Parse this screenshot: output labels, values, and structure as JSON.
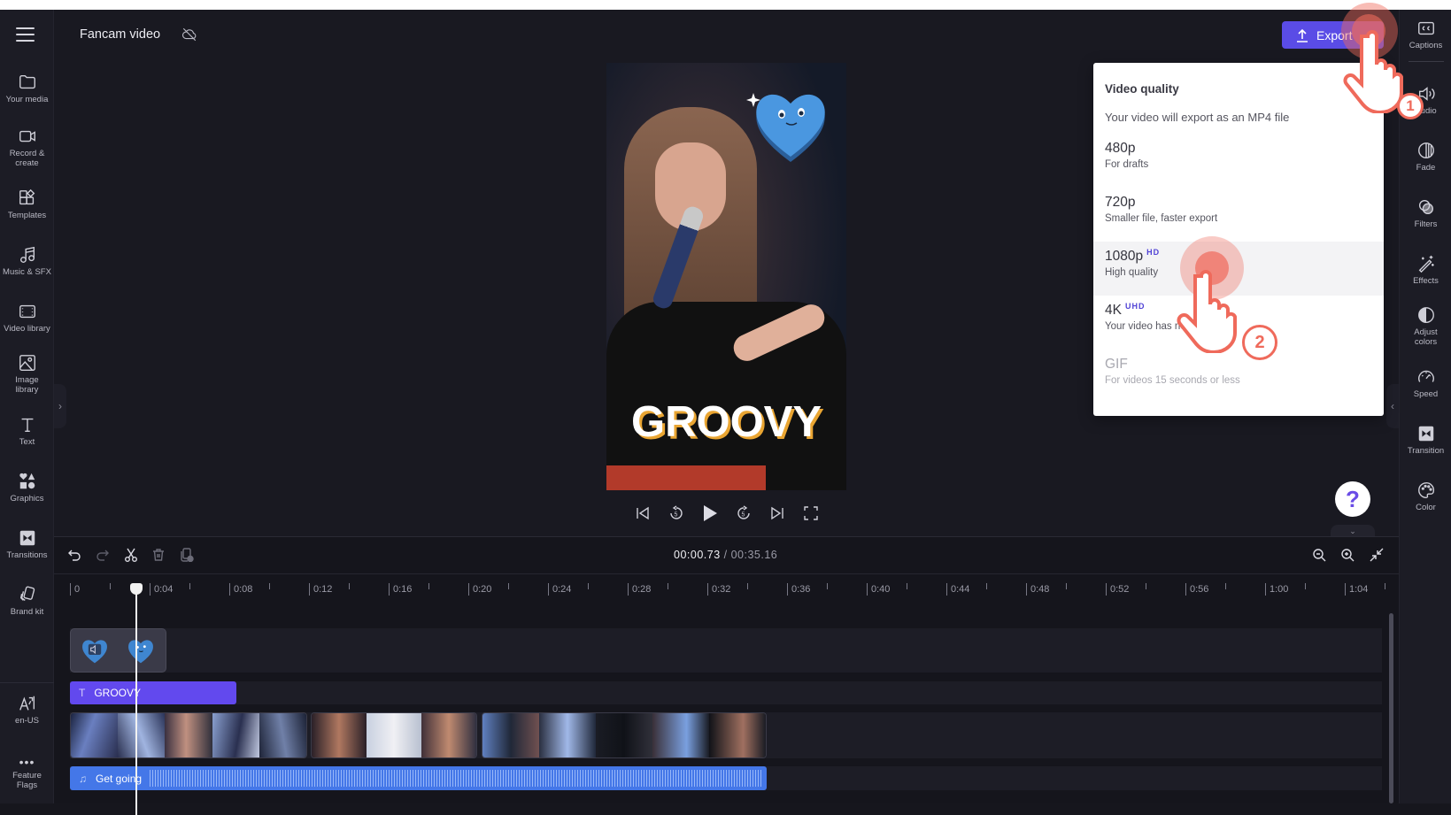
{
  "header": {
    "project_title": "Fancam video",
    "sync_status_icon": "cloud-off-icon",
    "export_label": "Export"
  },
  "left_sidebar": {
    "items": [
      {
        "label": "Your media",
        "icon": "folder-icon"
      },
      {
        "label": "Record & create",
        "icon": "camera-icon"
      },
      {
        "label": "Templates",
        "icon": "templates-icon"
      },
      {
        "label": "Music & SFX",
        "icon": "music-icon"
      },
      {
        "label": "Video library",
        "icon": "film-icon"
      },
      {
        "label": "Image library",
        "icon": "image-icon"
      },
      {
        "label": "Text",
        "icon": "text-icon"
      },
      {
        "label": "Graphics",
        "icon": "shapes-icon"
      },
      {
        "label": "Transitions",
        "icon": "transition-icon"
      },
      {
        "label": "Brand kit",
        "icon": "brand-kit-icon"
      }
    ],
    "bottom_items": [
      {
        "label": "en-US",
        "icon": "language-icon"
      },
      {
        "label": "Feature Flags",
        "icon": "more-icon"
      }
    ]
  },
  "right_sidebar": {
    "items": [
      {
        "label": "Captions",
        "icon": "cc-icon"
      },
      {
        "label": "Audio",
        "icon": "audio-icon"
      },
      {
        "label": "Fade",
        "icon": "fade-icon"
      },
      {
        "label": "Filters",
        "icon": "filters-icon"
      },
      {
        "label": "Effects",
        "icon": "magic-wand-icon"
      },
      {
        "label": "Adjust colors",
        "icon": "contrast-icon"
      },
      {
        "label": "Speed",
        "icon": "speedometer-icon"
      },
      {
        "label": "Transition",
        "icon": "transition-icon"
      },
      {
        "label": "Color",
        "icon": "palette-icon"
      }
    ]
  },
  "preview": {
    "overlay_text": "GROOVY",
    "sticker": "blue heart sticker"
  },
  "export_menu": {
    "title": "Video quality",
    "subtitle": "Your video will export as an MP4 file",
    "options": [
      {
        "name": "480p",
        "badge": "",
        "desc": "For drafts",
        "state": "enabled"
      },
      {
        "name": "720p",
        "badge": "",
        "desc": "Smaller file, faster export",
        "state": "enabled"
      },
      {
        "name": "1080p",
        "badge": "HD",
        "desc": "High quality",
        "state": "highlighted"
      },
      {
        "name": "4K",
        "badge": "UHD",
        "desc": "Your video has no 4K",
        "state": "enabled"
      },
      {
        "name": "GIF",
        "badge": "",
        "desc": "For videos 15 seconds or less",
        "state": "disabled"
      }
    ]
  },
  "timeline": {
    "current_time": "00:00.73",
    "total_time": "/ 00:35.16",
    "ruler_labels": [
      "0",
      "0:04",
      "0:08",
      "0:12",
      "0:16",
      "0:20",
      "0:24",
      "0:28",
      "0:32",
      "0:36",
      "0:40",
      "0:44",
      "0:48",
      "0:52",
      "0:56",
      "1:00",
      "1:04"
    ],
    "tracks": {
      "text_clip": "GROOVY",
      "audio_clip": "Get going"
    }
  },
  "annotations": {
    "step1": "1",
    "step2": "2"
  },
  "colors": {
    "accent": "#5a4ce6",
    "text_clip": "#6249ee",
    "audio_clip": "#4477e8",
    "annotation": "#ef6a5b"
  }
}
